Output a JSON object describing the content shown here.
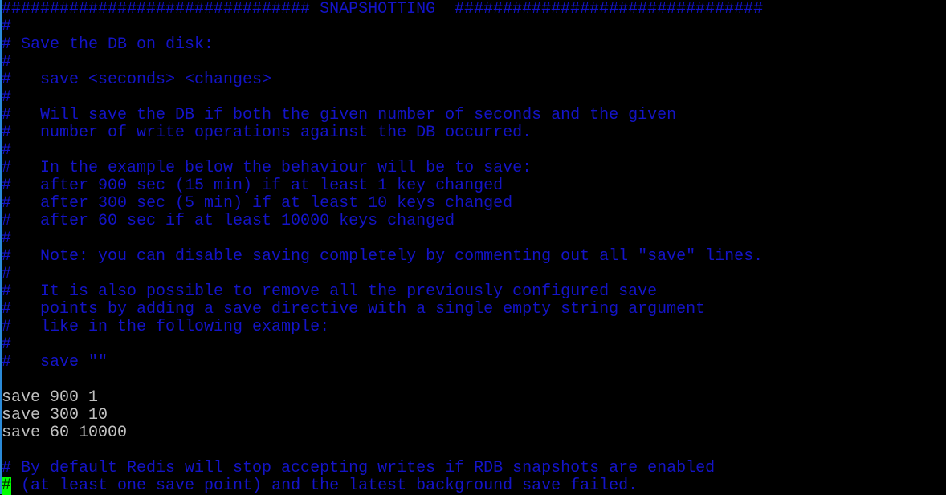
{
  "terminal": {
    "colors": {
      "background": "#000000",
      "comment_text": "#1414c8",
      "code_text": "#c0c0c0",
      "cursor": "#00ff00",
      "window_edge": "#2a8ad8"
    },
    "lines": [
      {
        "type": "comment",
        "text": "################################ SNAPSHOTTING  ################################"
      },
      {
        "type": "comment",
        "text": "#"
      },
      {
        "type": "comment",
        "text": "# Save the DB on disk:"
      },
      {
        "type": "comment",
        "text": "#"
      },
      {
        "type": "comment",
        "text": "#   save <seconds> <changes>"
      },
      {
        "type": "comment",
        "text": "#"
      },
      {
        "type": "comment",
        "text": "#   Will save the DB if both the given number of seconds and the given"
      },
      {
        "type": "comment",
        "text": "#   number of write operations against the DB occurred."
      },
      {
        "type": "comment",
        "text": "#"
      },
      {
        "type": "comment",
        "text": "#   In the example below the behaviour will be to save:"
      },
      {
        "type": "comment",
        "text": "#   after 900 sec (15 min) if at least 1 key changed"
      },
      {
        "type": "comment",
        "text": "#   after 300 sec (5 min) if at least 10 keys changed"
      },
      {
        "type": "comment",
        "text": "#   after 60 sec if at least 10000 keys changed"
      },
      {
        "type": "comment",
        "text": "#"
      },
      {
        "type": "comment",
        "text": "#   Note: you can disable saving completely by commenting out all \"save\" lines."
      },
      {
        "type": "comment",
        "text": "#"
      },
      {
        "type": "comment",
        "text": "#   It is also possible to remove all the previously configured save"
      },
      {
        "type": "comment",
        "text": "#   points by adding a save directive with a single empty string argument"
      },
      {
        "type": "comment",
        "text": "#   like in the following example:"
      },
      {
        "type": "comment",
        "text": "#"
      },
      {
        "type": "comment",
        "text": "#   save \"\""
      },
      {
        "type": "blank",
        "text": ""
      },
      {
        "type": "code",
        "text": "save 900 1"
      },
      {
        "type": "code",
        "text": "save 300 10"
      },
      {
        "type": "code",
        "text": "save 60 10000"
      },
      {
        "type": "blank",
        "text": ""
      },
      {
        "type": "comment",
        "text": "# By default Redis will stop accepting writes if RDB snapshots are enabled"
      },
      {
        "type": "comment",
        "cursor_char": "#",
        "text": " (at least one save point) and the latest background save failed."
      }
    ]
  }
}
